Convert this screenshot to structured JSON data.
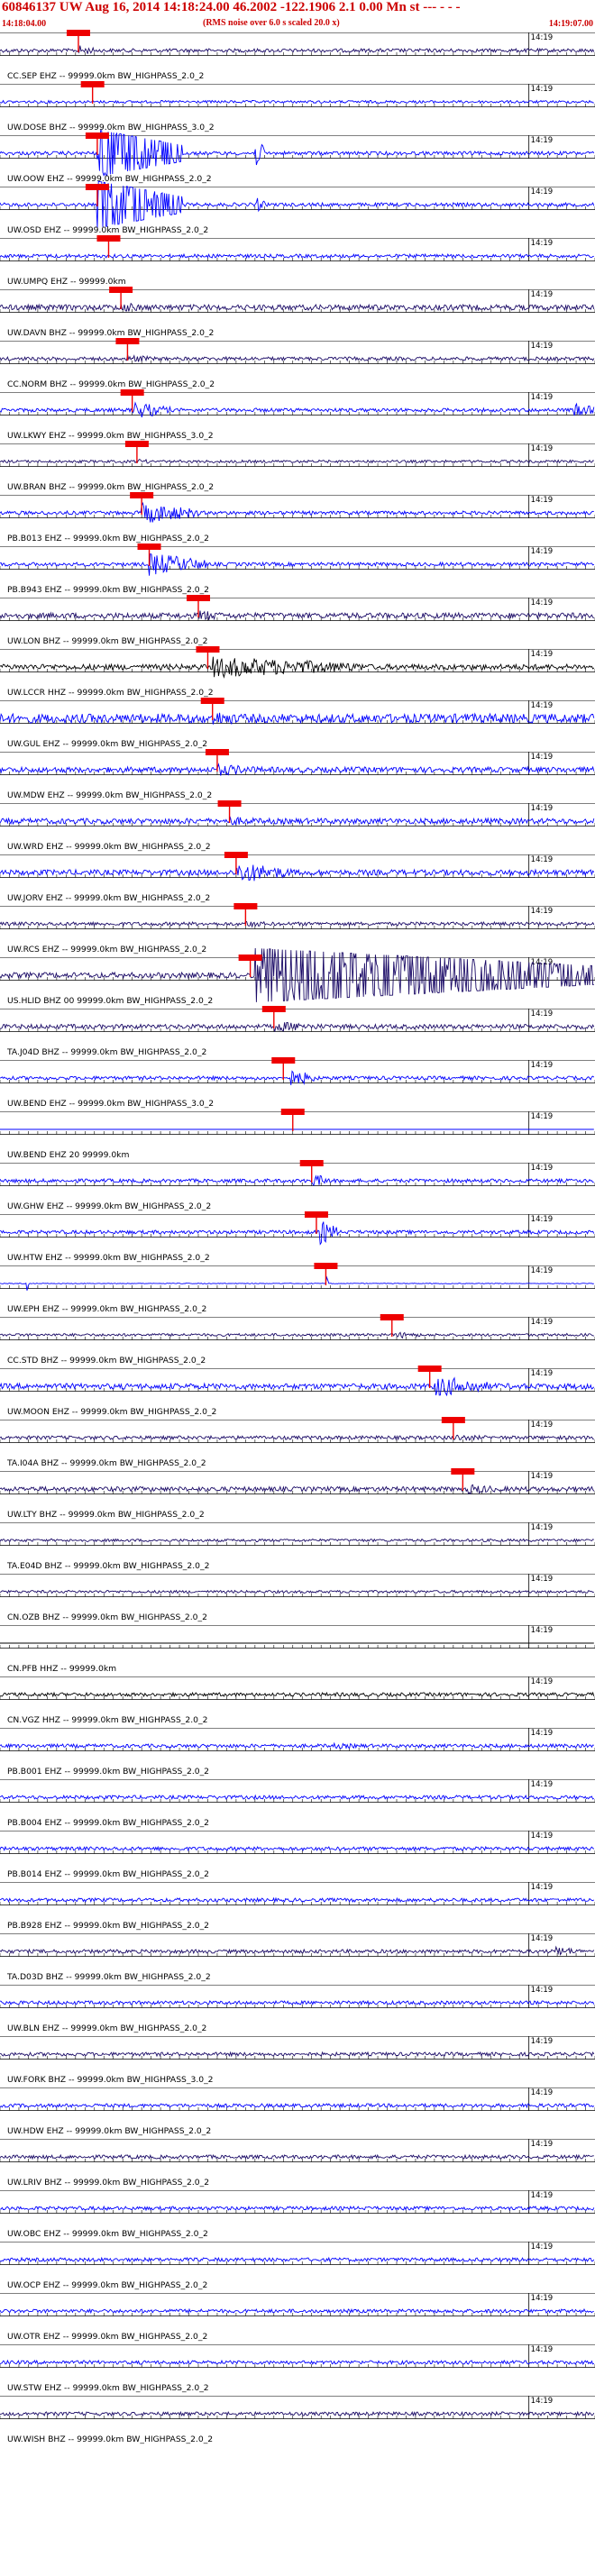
{
  "header": {
    "title": "60846137 UW Aug 16, 2014 14:18:24.00   46.2002 -122.1906  2.1 0.00 Mn st --- - - -",
    "subtitle": "(RMS noise over 6.0 s scaled 20.0 x)",
    "time_start": "14:18:04.00",
    "time_end": "14:19:07.00"
  },
  "colors": {
    "black": "#000000",
    "blue": "#0000ff",
    "indigo": "#1a0a66",
    "pick": "#ee0000"
  },
  "chart_data": {
    "type": "line",
    "title": "60846137 UW Aug 16, 2014 14:18:24.00   46.2002 -122.1906  2.1 0.00 Mn st --- - - -",
    "xlabel": "",
    "ylabel": "",
    "minute_label": "14:19",
    "traces": [
      {
        "label": "CC.SEP EHZ -- 99999.0km BW_HIGHPASS_2.0_2",
        "color": "indigo",
        "amp": 2,
        "pick": 8.3,
        "events": [
          {
            "t": 8.3,
            "a": 6,
            "d": 2
          }
        ]
      },
      {
        "label": "UW.DOSE BHZ -- 99999.0km BW_HIGHPASS_3.0_2",
        "color": "blue",
        "amp": 1.5,
        "pick": 9.8,
        "events": []
      },
      {
        "label": "UW.OOW EHZ -- 99999.0km BW_HIGHPASS_2.0_2",
        "color": "blue",
        "amp": 2,
        "pick": 10.3,
        "events": [
          {
            "t": 10.3,
            "a": 26,
            "d": 9,
            "clip": true
          },
          {
            "t": 27.0,
            "a": 18,
            "d": 1
          }
        ]
      },
      {
        "label": "UW.OSD EHZ -- 99999.0km BW_HIGHPASS_2.0_2",
        "color": "blue",
        "amp": 2,
        "pick": 10.3,
        "events": [
          {
            "t": 10.3,
            "a": 26,
            "d": 9,
            "clip": true
          },
          {
            "t": 27.0,
            "a": 10,
            "d": 1
          }
        ]
      },
      {
        "label": "UW.UMPQ EHZ -- 99999.0km",
        "color": "blue",
        "amp": 2,
        "pick": 11.5,
        "events": []
      },
      {
        "label": "UW.DAVN BHZ -- 99999.0km BW_HIGHPASS_2.0_2",
        "color": "indigo",
        "amp": 3,
        "pick": 12.8,
        "events": [
          {
            "t": 12.8,
            "a": 6,
            "d": 3
          }
        ]
      },
      {
        "label": "CC.NORM BHZ -- 99999.0km BW_HIGHPASS_2.0_2",
        "color": "indigo",
        "amp": 2,
        "pick": 13.5,
        "events": [
          {
            "t": 13.5,
            "a": 5,
            "d": 3
          }
        ]
      },
      {
        "label": "UW.LKWY EHZ -- 99999.0km BW_HIGHPASS_3.0_2",
        "color": "blue",
        "amp": 2,
        "pick": 14.0,
        "events": [
          {
            "t": 14.0,
            "a": 10,
            "d": 4
          },
          {
            "t": 60.5,
            "a": 8,
            "d": 3
          }
        ]
      },
      {
        "label": "UW.BRAN BHZ -- 99999.0km BW_HIGHPASS_2.0_2",
        "color": "indigo",
        "amp": 1.5,
        "pick": 14.5,
        "events": [
          {
            "t": 14.6,
            "a": 3,
            "d": 2
          }
        ]
      },
      {
        "label": "PB.B013 EHZ -- 99999.0km BW_HIGHPASS_2.0_2",
        "color": "blue",
        "amp": 2,
        "pick": 15.0,
        "events": [
          {
            "t": 15.0,
            "a": 12,
            "d": 6
          }
        ]
      },
      {
        "label": "PB.B943 EHZ -- 99999.0km BW_HIGHPASS_2.0_2",
        "color": "blue",
        "amp": 2,
        "pick": 15.8,
        "events": [
          {
            "t": 15.8,
            "a": 13,
            "d": 6
          }
        ]
      },
      {
        "label": "UW.LON BHZ -- 99999.0km BW_HIGHPASS_2.0_2",
        "color": "indigo",
        "amp": 3,
        "pick": 21.0,
        "events": [
          {
            "t": 21.0,
            "a": 7,
            "d": 3
          }
        ]
      },
      {
        "label": "UW.LCCR HHZ -- 99999.0km BW_HIGHPASS_2.0_2",
        "color": "black",
        "amp": 3,
        "pick": 22.0,
        "events": [
          {
            "t": 22.5,
            "a": 12,
            "d": 16
          }
        ]
      },
      {
        "label": "UW.GUL EHZ -- 99999.0km BW_HIGHPASS_2.0_2",
        "color": "blue",
        "amp": 5,
        "pick": 22.5,
        "events": [
          {
            "t": 22.5,
            "a": 9,
            "d": 4
          }
        ]
      },
      {
        "label": "UW.MDW EHZ -- 99999.0km BW_HIGHPASS_2.0_2",
        "color": "blue",
        "amp": 3,
        "pick": 23.0,
        "events": [
          {
            "t": 23.0,
            "a": 7,
            "d": 5
          }
        ]
      },
      {
        "label": "UW.WRD EHZ -- 99999.0km BW_HIGHPASS_2.0_2",
        "color": "blue",
        "amp": 3,
        "pick": 24.3,
        "events": [
          {
            "t": 24.3,
            "a": 5,
            "d": 5
          }
        ]
      },
      {
        "label": "UW.JORV EHZ -- 99999.0km BW_HIGHPASS_2.0_2",
        "color": "blue",
        "amp": 3,
        "pick": 25.0,
        "events": [
          {
            "t": 25.0,
            "a": 12,
            "d": 6
          }
        ]
      },
      {
        "label": "UW.RCS EHZ -- 99999.0km BW_HIGHPASS_2.0_2",
        "color": "indigo",
        "amp": 2,
        "pick": 26.0,
        "events": [
          {
            "t": 26.0,
            "a": 4,
            "d": 3
          }
        ]
      },
      {
        "label": "US.HLID BHZ 00 99999.0km BW_HIGHPASS_2.0_2",
        "color": "indigo",
        "amp": 3,
        "pick": 26.5,
        "events": [
          {
            "t": 27.0,
            "a": 30,
            "d": 36,
            "clip": true
          }
        ]
      },
      {
        "label": "TA.J04D BHZ -- 99999.0km BW_HIGHPASS_2.0_2",
        "color": "indigo",
        "amp": 2.5,
        "pick": 29.0,
        "events": [
          {
            "t": 29.0,
            "a": 6,
            "d": 6
          }
        ]
      },
      {
        "label": "UW.BEND EHZ -- 99999.0km BW_HIGHPASS_3.0_2",
        "color": "blue",
        "amp": 2,
        "pick": 30.0,
        "events": [
          {
            "t": 30.5,
            "a": 10,
            "d": 3
          }
        ]
      },
      {
        "label": "UW.BEND EHZ 20 99999.0km",
        "color": "blue",
        "amp": 0,
        "pick": 31.0,
        "events": []
      },
      {
        "label": "UW.GHW EHZ -- 99999.0km BW_HIGHPASS_2.0_2",
        "color": "blue",
        "amp": 2,
        "pick": 33.0,
        "events": [
          {
            "t": 33.0,
            "a": 8,
            "d": 2
          }
        ]
      },
      {
        "label": "UW.HTW EHZ -- 99999.0km BW_HIGHPASS_2.0_2",
        "color": "blue",
        "amp": 2,
        "pick": 33.5,
        "events": [
          {
            "t": 33.8,
            "a": 14,
            "d": 2
          }
        ]
      },
      {
        "label": "UW.EPH EHZ -- 99999.0km BW_HIGHPASS_2.0_2",
        "color": "blue",
        "amp": 0.4,
        "pick": 34.5,
        "events": [
          {
            "t": 2.8,
            "a": 10,
            "d": 0.2
          },
          {
            "t": 34.5,
            "a": 10,
            "d": 0.3
          }
        ]
      },
      {
        "label": "CC.STD BHZ -- 99999.0km BW_HIGHPASS_2.0_2",
        "color": "indigo",
        "amp": 1.5,
        "pick": 41.5,
        "events": [
          {
            "t": 42.0,
            "a": 4,
            "d": 3
          }
        ]
      },
      {
        "label": "UW.MOON EHZ -- 99999.0km BW_HIGHPASS_2.0_2",
        "color": "blue",
        "amp": 3,
        "pick": 45.5,
        "events": [
          {
            "t": 46.0,
            "a": 12,
            "d": 6
          }
        ]
      },
      {
        "label": "TA.I04A BHZ -- 99999.0km BW_HIGHPASS_2.0_2",
        "color": "indigo",
        "amp": 2,
        "pick": 48.0,
        "events": [
          {
            "t": 48.0,
            "a": 4,
            "d": 4
          }
        ]
      },
      {
        "label": "UW.LTY BHZ -- 99999.0km BW_HIGHPASS_2.0_2",
        "color": "indigo",
        "amp": 2.5,
        "pick": 49.0,
        "events": [
          {
            "t": 49.5,
            "a": 6,
            "d": 4
          }
        ]
      },
      {
        "label": "TA.E04D BHZ -- 99999.0km BW_HIGHPASS_2.0_2",
        "color": "indigo",
        "amp": 1.5,
        "pick": null,
        "events": []
      },
      {
        "label": "CN.OZB BHZ -- 99999.0km BW_HIGHPASS_2.0_2",
        "color": "indigo",
        "amp": 1.5,
        "pick": null,
        "events": []
      },
      {
        "label": "CN.PFB HHZ -- 99999.0km",
        "color": "black",
        "amp": 0,
        "pick": null,
        "events": []
      },
      {
        "label": "CN.VGZ HHZ -- 99999.0km BW_HIGHPASS_2.0_2",
        "color": "black",
        "amp": 2,
        "pick": null,
        "events": []
      },
      {
        "label": "PB.B001 EHZ -- 99999.0km BW_HIGHPASS_2.0_2",
        "color": "blue",
        "amp": 2,
        "pick": null,
        "events": [
          {
            "t": 35.0,
            "a": 3,
            "d": 8
          }
        ]
      },
      {
        "label": "PB.B004 EHZ -- 99999.0km BW_HIGHPASS_2.0_2",
        "color": "blue",
        "amp": 2,
        "pick": null,
        "events": []
      },
      {
        "label": "PB.B014 EHZ -- 99999.0km BW_HIGHPASS_2.0_2",
        "color": "blue",
        "amp": 2,
        "pick": null,
        "events": []
      },
      {
        "label": "PB.B928 EHZ -- 99999.0km BW_HIGHPASS_2.0_2",
        "color": "blue",
        "amp": 2,
        "pick": null,
        "events": []
      },
      {
        "label": "TA.D03D BHZ -- 99999.0km BW_HIGHPASS_2.0_2",
        "color": "indigo",
        "amp": 2,
        "pick": null,
        "events": [
          {
            "t": 58.5,
            "a": 6,
            "d": 3
          }
        ]
      },
      {
        "label": "UW.BLN EHZ -- 99999.0km BW_HIGHPASS_2.0_2",
        "color": "blue",
        "amp": 2,
        "pick": null,
        "events": []
      },
      {
        "label": "UW.FORK BHZ -- 99999.0km BW_HIGHPASS_3.0_2",
        "color": "indigo",
        "amp": 2,
        "pick": null,
        "events": []
      },
      {
        "label": "UW.HDW EHZ -- 99999.0km BW_HIGHPASS_2.0_2",
        "color": "blue",
        "amp": 2,
        "pick": null,
        "events": []
      },
      {
        "label": "UW.LRIV BHZ -- 99999.0km BW_HIGHPASS_2.0_2",
        "color": "indigo",
        "amp": 2,
        "pick": null,
        "events": []
      },
      {
        "label": "UW.OBC EHZ -- 99999.0km BW_HIGHPASS_2.0_2",
        "color": "blue",
        "amp": 2,
        "pick": null,
        "events": []
      },
      {
        "label": "UW.OCP EHZ -- 99999.0km BW_HIGHPASS_2.0_2",
        "color": "blue",
        "amp": 2,
        "pick": null,
        "events": []
      },
      {
        "label": "UW.OTR EHZ -- 99999.0km BW_HIGHPASS_2.0_2",
        "color": "blue",
        "amp": 2,
        "pick": null,
        "events": []
      },
      {
        "label": "UW.STW EHZ -- 99999.0km BW_HIGHPASS_2.0_2",
        "color": "blue",
        "amp": 2,
        "pick": null,
        "events": []
      },
      {
        "label": "UW.WISH BHZ -- 99999.0km BW_HIGHPASS_2.0_2",
        "color": "indigo",
        "amp": 2,
        "pick": null,
        "events": []
      }
    ]
  }
}
